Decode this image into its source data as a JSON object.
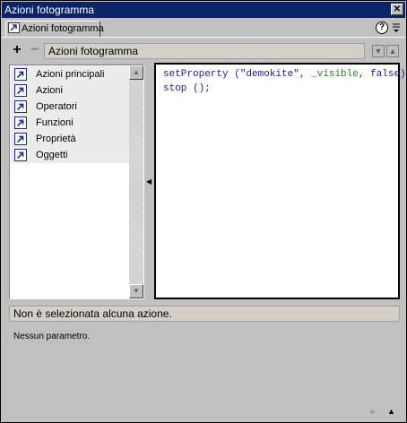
{
  "window": {
    "title": "Azioni fotogramma"
  },
  "tab": {
    "label": "Azioni fotogramma"
  },
  "toolbar": {
    "add_label": "+",
    "remove_label": "−",
    "header": "Azioni fotogramma"
  },
  "tree": {
    "items": [
      {
        "label": "Azioni principali"
      },
      {
        "label": "Azioni"
      },
      {
        "label": "Operatori"
      },
      {
        "label": "Funzioni"
      },
      {
        "label": "Proprietà"
      },
      {
        "label": "Oggetti"
      }
    ]
  },
  "script": {
    "line1": {
      "func": "setProperty",
      "open": " (",
      "arg1": "\"demokite\"",
      "sep1": ", ",
      "arg2": "_visible",
      "sep2": ", ",
      "arg3": "false",
      "close": ");"
    },
    "line2": {
      "func": "stop",
      "rest": " ();"
    }
  },
  "status": {
    "text": "Non è selezionata alcuna azione."
  },
  "params": {
    "text": "Nessun parametro."
  },
  "icons": {
    "tab": "action-arrow-icon",
    "book": "book-arrow-icon",
    "help": "help-icon",
    "close": "close-icon"
  },
  "colors": {
    "titlebar": "#0a246a",
    "keyword": "#1a1a9a",
    "property": "#1a8a1a"
  }
}
